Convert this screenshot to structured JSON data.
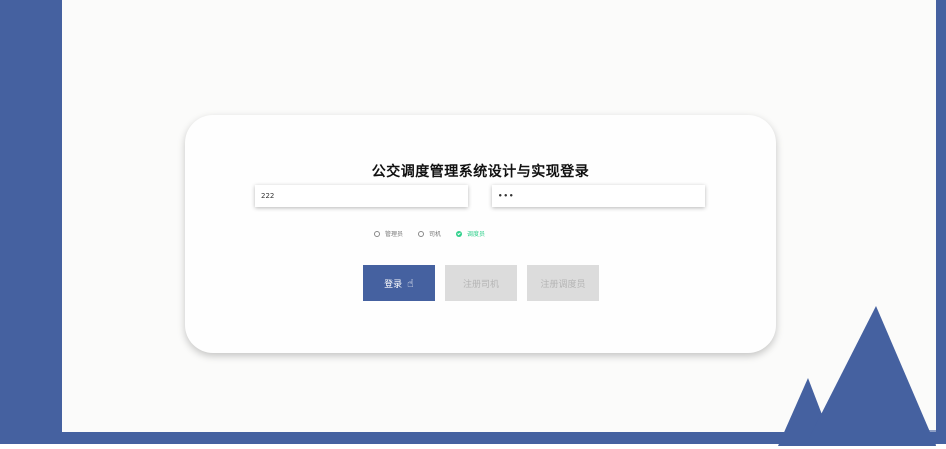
{
  "form": {
    "title": "公交调度管理系统设计与实现登录",
    "username_value": "222",
    "password_value": "•••"
  },
  "roles": [
    {
      "label": "管理员",
      "selected": false
    },
    {
      "label": "司机",
      "selected": false
    },
    {
      "label": "调度员",
      "selected": true
    }
  ],
  "buttons": {
    "login": "登录",
    "register_driver": "注册司机",
    "register_dispatcher": "注册调度员"
  },
  "colors": {
    "brand": "#4561a0",
    "selected_role": "#2fd08b",
    "disabled_button": "#dcdcdc"
  }
}
